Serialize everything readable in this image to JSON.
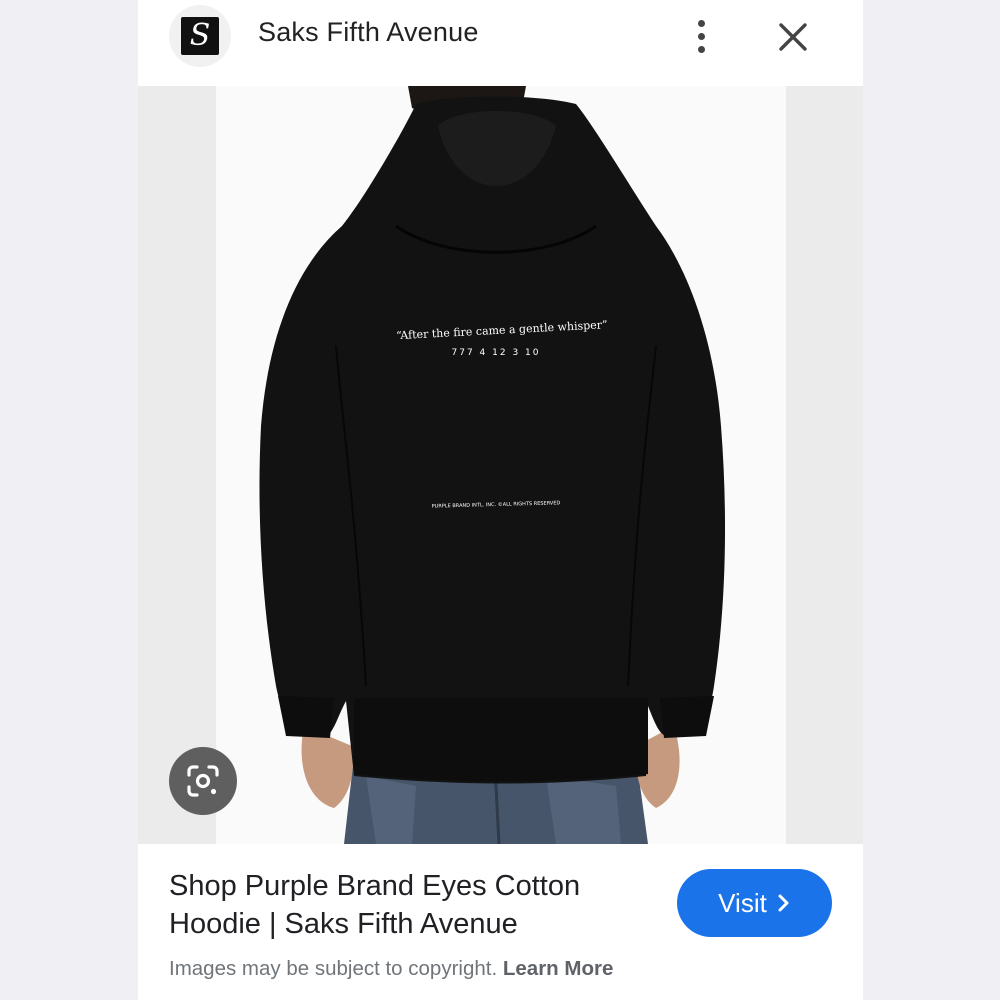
{
  "header": {
    "site_name": "Saks Fifth Avenue",
    "logo_letter": "S",
    "more_icon": "more-vert-icon",
    "close_icon": "close-icon"
  },
  "image": {
    "print_quote": "“After the fire came a gentle whisper”",
    "print_numbers": "777 4 12 3 10",
    "print_copyright": "PURPLE BRAND INTL. INC. ©ALL RIGHTS RESERVED",
    "lens_icon": "lens-search-icon"
  },
  "result": {
    "title": "Shop Purple Brand Eyes Cotton Hoodie | Saks Fifth Avenue",
    "visit_label": "Visit",
    "visit_icon": "chevron-right-icon",
    "copyright_text": "Images may be subject to copyright.",
    "learn_more_label": "Learn More"
  },
  "colors": {
    "accent": "#1a73e8",
    "hoodie": "#111111",
    "page_background": "#efeff4"
  }
}
